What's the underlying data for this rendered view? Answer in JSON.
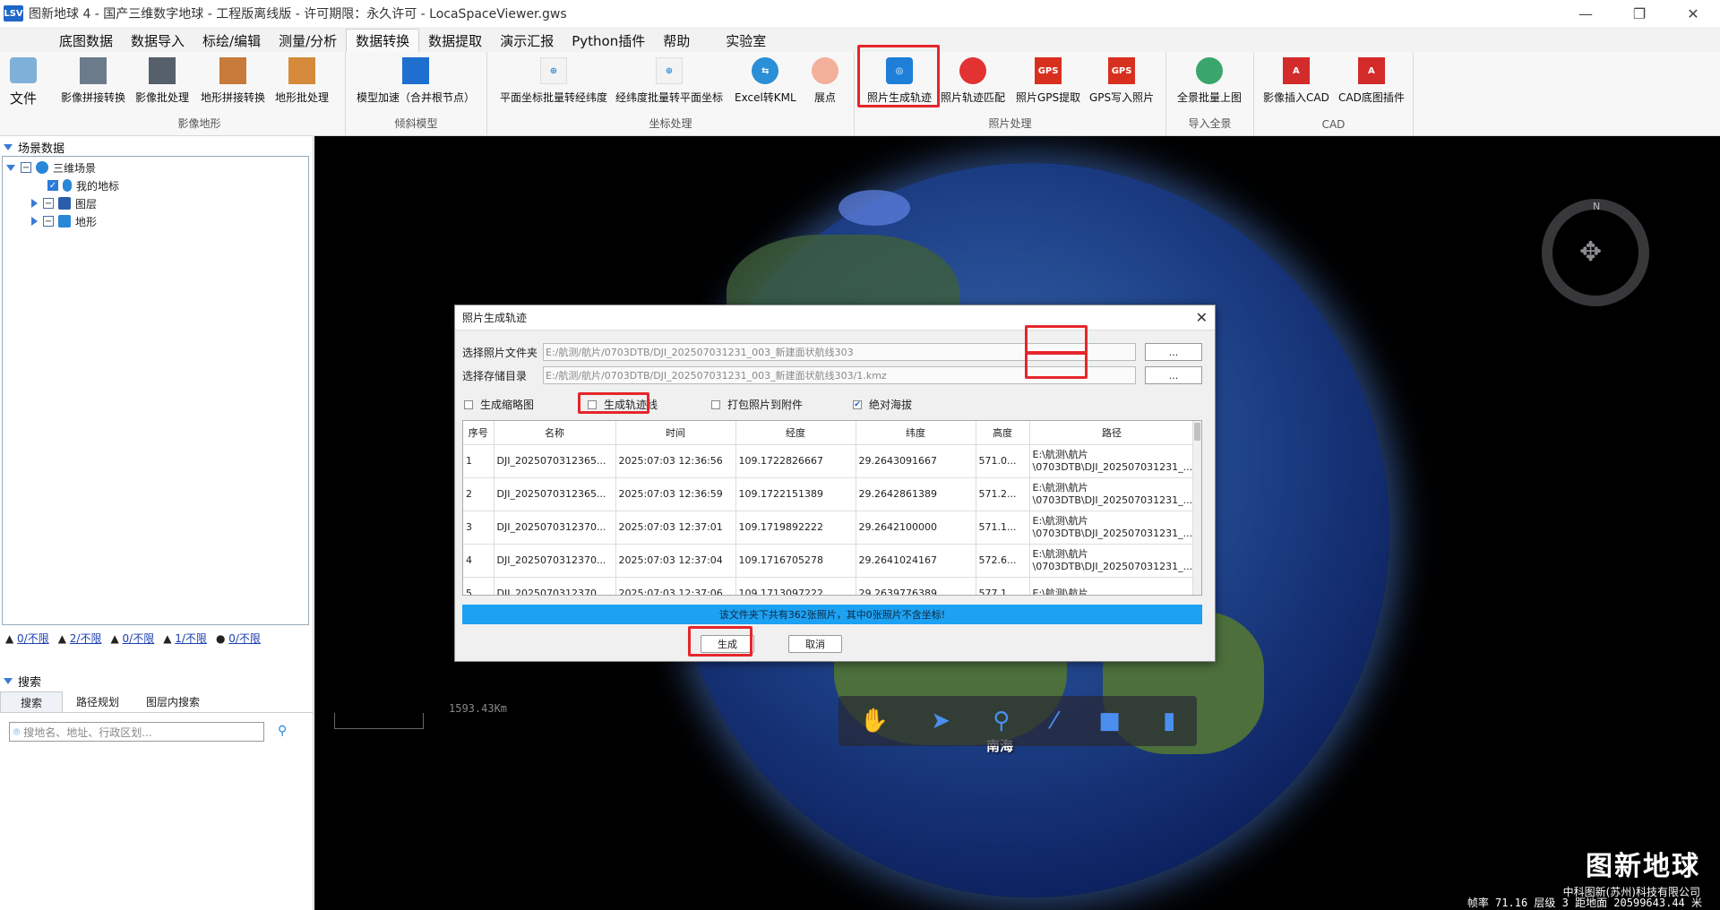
{
  "window": {
    "title": "图新地球 4 - 国产三维数字地球 - 工程版离线版 - 许可期限：永久许可 - LocaSpaceViewer.gws",
    "icon": "LSV",
    "minimize": "—",
    "restore": "❐",
    "close": "✕"
  },
  "menu": {
    "tabs": [
      "底图数据",
      "数据导入",
      "标绘/编辑",
      "测量/分析",
      "数据转换",
      "数据提取",
      "演示汇报",
      "Python插件",
      "帮助",
      "实验室"
    ],
    "active": "数据转换"
  },
  "ribbon": {
    "file": "文件",
    "groups": [
      {
        "label": "影像地形",
        "buttons": [
          "影像拼接转换",
          "影像批处理",
          "地形拼接转换",
          "地形批处理"
        ]
      },
      {
        "label": "倾斜模型",
        "buttons": [
          "模型加速（合并根节点）"
        ]
      },
      {
        "label": "坐标处理",
        "buttons": [
          "平面坐标批量转经纬度",
          "经纬度批量转平面坐标",
          "Excel转KML",
          "展点"
        ]
      },
      {
        "label": "照片处理",
        "buttons": [
          "照片生成轨迹",
          "照片轨迹匹配",
          "照片GPS提取",
          "GPS写入照片"
        ]
      },
      {
        "label": "导入全景",
        "buttons": [
          "全景批量上图"
        ]
      },
      {
        "label": "CAD",
        "buttons": [
          "影像插入CAD",
          "CAD底图插件"
        ]
      }
    ],
    "gps_badge": "GPS"
  },
  "left": {
    "scene_header": "场景数据",
    "tree": {
      "root": "三维场景",
      "items": [
        "我的地标",
        "图层",
        "地形"
      ]
    },
    "stats": [
      "0/不限",
      "2/不限",
      "0/不限",
      "1/不限",
      "0/不限"
    ],
    "search_header": "搜索",
    "search_tabs": [
      "搜索",
      "路径规划",
      "图层内搜索"
    ],
    "search_placeholder": "搜地名、地址、行政区划..."
  },
  "map": {
    "scale_text": "1593.43Km",
    "sea_label": "南海",
    "brand": "图新地球",
    "company": "中科图新(苏州)科技有限公司",
    "status": "帧率 71.16  层级 3  距地面 20599643.44 米",
    "compass_n": "N"
  },
  "dialog": {
    "title": "照片生成轨迹",
    "folder_label": "选择照片文件夹",
    "folder_value": "E:/航测/航片/0703DTB/DJI_202507031231_003_新建面状航线303",
    "save_label": "选择存储目录",
    "save_value": "E:/航测/航片/0703DTB/DJI_202507031231_003_新建面状航线303/1.kmz",
    "browse": "...",
    "options": [
      {
        "label": "生成缩略图",
        "checked": false
      },
      {
        "label": "生成轨迹线",
        "checked": false
      },
      {
        "label": "打包照片到附件",
        "checked": false
      },
      {
        "label": "绝对海拔",
        "checked": true
      }
    ],
    "columns": [
      "序号",
      "名称",
      "时间",
      "经度",
      "纬度",
      "高度",
      "路径"
    ],
    "rows": [
      [
        "1",
        "DJI_2025070312365...",
        "2025:07:03 12:36:56",
        "109.1722826667",
        "29.2643091667",
        "571.0...",
        "E:\\航测\\航片\n\\0703DTB\\DJI_202507031231_..."
      ],
      [
        "2",
        "DJI_2025070312365...",
        "2025:07:03 12:36:59",
        "109.1722151389",
        "29.2642861389",
        "571.2...",
        "E:\\航测\\航片\n\\0703DTB\\DJI_202507031231_..."
      ],
      [
        "3",
        "DJI_2025070312370...",
        "2025:07:03 12:37:01",
        "109.1719892222",
        "29.2642100000",
        "571.1...",
        "E:\\航测\\航片\n\\0703DTB\\DJI_202507031231_..."
      ],
      [
        "4",
        "DJI_2025070312370...",
        "2025:07:03 12:37:04",
        "109.1716705278",
        "29.2641024167",
        "572.6...",
        "E:\\航测\\航片\n\\0703DTB\\DJI_202507031231_..."
      ],
      [
        "5",
        "DJI_2025070312370...",
        "2025:07:03 12:37:06",
        "109.1713097222",
        "29.2639776389",
        "577.1...",
        "E:\\航测\\航片"
      ]
    ],
    "info": "该文件夹下共有362张照片，其中0张照片不含坐标!",
    "generate": "生成",
    "cancel": "取消"
  }
}
